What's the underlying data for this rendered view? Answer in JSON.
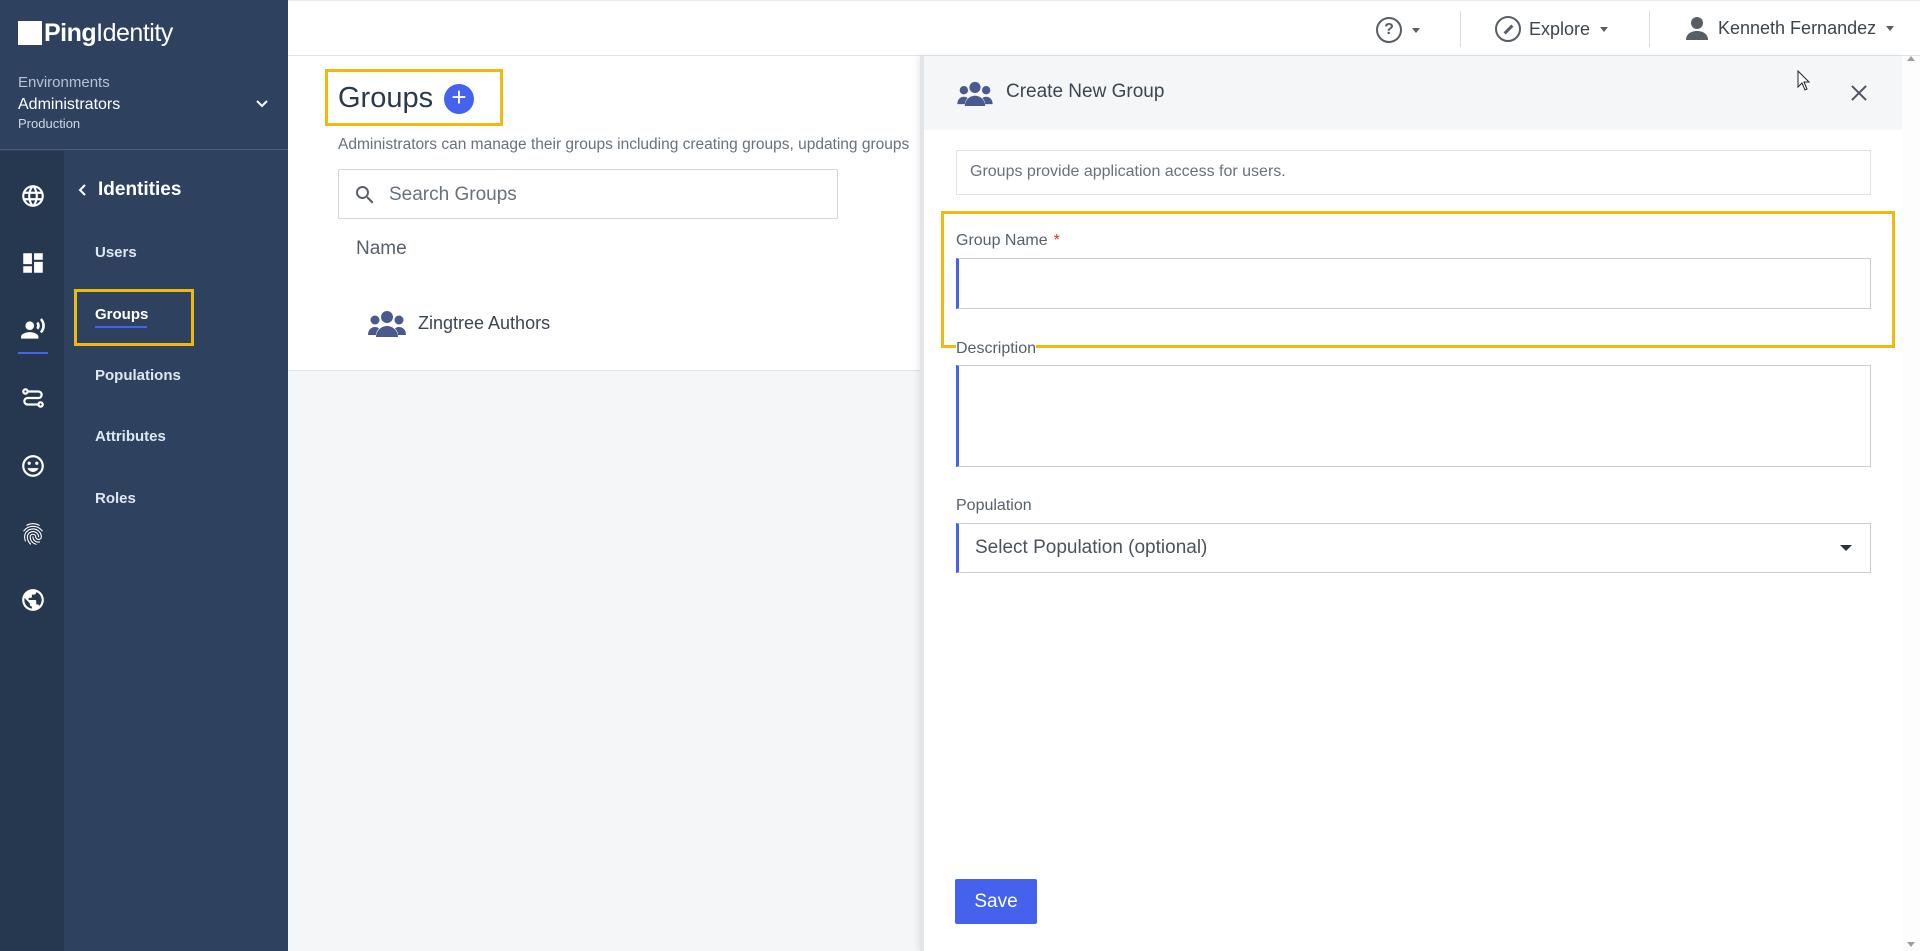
{
  "brand": {
    "ping": "Ping",
    "identity": "Identity"
  },
  "environment": {
    "label": "Environments",
    "name": "Administrators",
    "type": "Production"
  },
  "rail": [
    {
      "icon": "globe-icon"
    },
    {
      "icon": "dashboard-icon"
    },
    {
      "icon": "identities-icon",
      "active": true
    },
    {
      "icon": "connections-icon"
    },
    {
      "icon": "experiences-icon"
    },
    {
      "icon": "fingerprint-icon"
    },
    {
      "icon": "world-icon"
    }
  ],
  "subnav": {
    "title": "Identities",
    "items": [
      {
        "label": "Users"
      },
      {
        "label": "Groups",
        "active": true
      },
      {
        "label": "Populations"
      },
      {
        "label": "Attributes"
      },
      {
        "label": "Roles"
      }
    ]
  },
  "header": {
    "explore": "Explore",
    "user": "Kenneth Fernandez"
  },
  "main": {
    "title": "Groups",
    "add_symbol": "+",
    "description": "Administrators can manage their groups including creating groups, updating groups",
    "search_placeholder": "Search Groups",
    "column_name": "Name",
    "rows": [
      {
        "name": "Zingtree Authors"
      }
    ]
  },
  "panel": {
    "title": "Create New Group",
    "info": "Groups provide application access for users.",
    "group_name_label": "Group Name",
    "required_mark": "*",
    "description_label": "Description",
    "population_label": "Population",
    "population_placeholder": "Select Population (optional)",
    "save_label": "Save"
  },
  "colors": {
    "accent": "#4462ed",
    "sidebar": "#2e4260",
    "highlight": "#f2b812"
  }
}
